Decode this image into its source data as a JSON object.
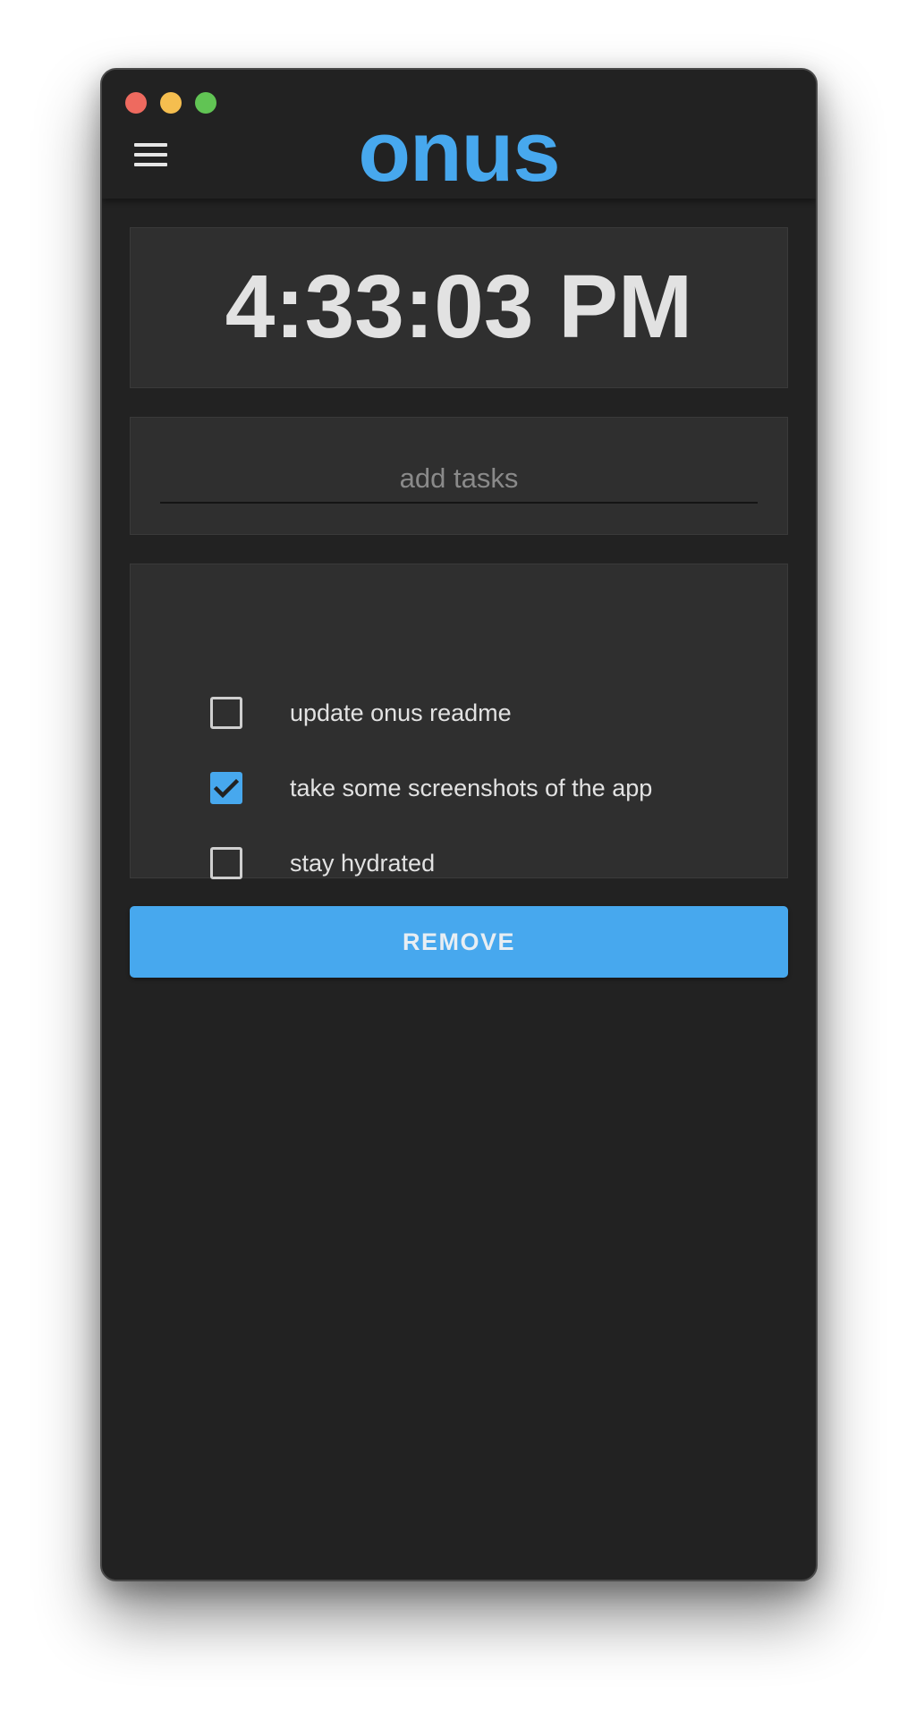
{
  "app": {
    "title": "onus",
    "accent_color": "#47a8ee"
  },
  "window": {
    "traffic_lights": [
      "close",
      "minimize",
      "maximize"
    ],
    "menu_icon": "hamburger-menu-icon"
  },
  "clock": {
    "time": "4:33:03 PM"
  },
  "task_input": {
    "value": "",
    "placeholder": "add tasks"
  },
  "tasks": [
    {
      "label": "update onus readme",
      "checked": false
    },
    {
      "label": "take some screenshots of the app",
      "checked": true
    },
    {
      "label": "stay hydrated",
      "checked": false
    }
  ],
  "actions": {
    "remove_label": "REMOVE"
  }
}
